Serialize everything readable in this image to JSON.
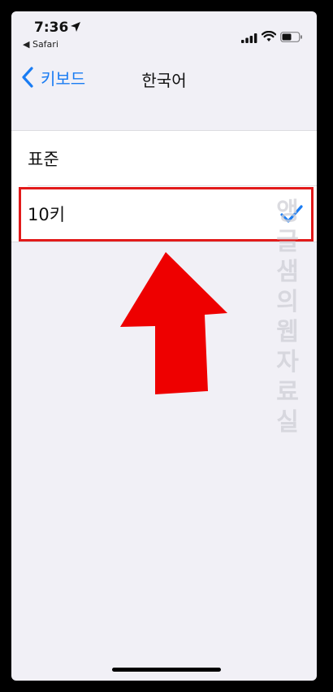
{
  "statusbar": {
    "time": "7:36",
    "back_app": "◀ Safari"
  },
  "navbar": {
    "back_label": "키보드",
    "title": "한국어"
  },
  "list": {
    "items": [
      {
        "label": "표준",
        "selected": false
      },
      {
        "label": "10키",
        "selected": true
      }
    ]
  },
  "watermark": "앵글샘의웹자료실",
  "colors": {
    "accent": "#1a7cf3",
    "highlight": "#e21a1a",
    "background": "#f1f0f6"
  }
}
